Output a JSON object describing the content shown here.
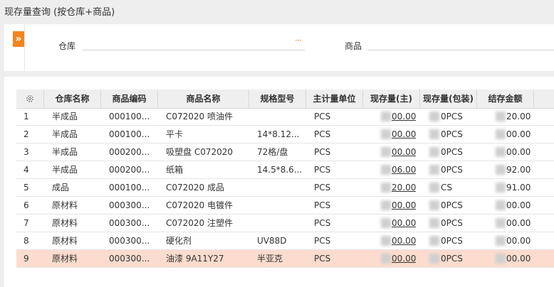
{
  "page": {
    "title": "现存量查询 (按仓库+商品)"
  },
  "filters": {
    "expand_icon": "»",
    "warehouse_label": "仓库",
    "warehouse_value": "",
    "warehouse_more": "···",
    "product_label": "商品",
    "product_value": ""
  },
  "table": {
    "settings_icon": "gear-icon",
    "columns": [
      "仓库名称",
      "商品编码",
      "商品名称",
      "规格型号",
      "主计量单位",
      "现存量(主)",
      "现存量(包装)",
      "结存金额"
    ],
    "rows": [
      {
        "idx": "1",
        "warehouse": "半成品",
        "code": "000100...",
        "name": "C072020 喷油件",
        "spec": "",
        "unit": "PCS",
        "qty_main": "00.00",
        "qty_pack": "0PCS",
        "amount": "20.00"
      },
      {
        "idx": "2",
        "warehouse": "半成品",
        "code": "000100...",
        "name": "平卡",
        "spec": "14*8.12...",
        "unit": "PCS",
        "qty_main": "00.00",
        "qty_pack": "0PCS",
        "amount": "00.00"
      },
      {
        "idx": "3",
        "warehouse": "半成品",
        "code": "000200...",
        "name": "吸塑盘 C072020",
        "spec": "72格/盘",
        "unit": "PCS",
        "qty_main": "00.00",
        "qty_pack": "0PCS",
        "amount": "00.00"
      },
      {
        "idx": "4",
        "warehouse": "半成品",
        "code": "000200...",
        "name": "纸箱",
        "spec": "14.5*8.6...",
        "unit": "PCS",
        "qty_main": "06.00",
        "qty_pack": "0PCS",
        "amount": "92.00"
      },
      {
        "idx": "5",
        "warehouse": "成品",
        "code": "000100...",
        "name": "C072020 成品",
        "spec": "",
        "unit": "PCS",
        "qty_main": "20.00",
        "qty_pack": "CS",
        "amount": "91.00"
      },
      {
        "idx": "6",
        "warehouse": "原材料",
        "code": "000300...",
        "name": "C072020 电镀件",
        "spec": "",
        "unit": "PCS",
        "qty_main": "00.00",
        "qty_pack": "0PCS",
        "amount": "00.00"
      },
      {
        "idx": "7",
        "warehouse": "原材料",
        "code": "000300...",
        "name": "C072020 注塑件",
        "spec": "",
        "unit": "PCS",
        "qty_main": "00.00",
        "qty_pack": "0PCS",
        "amount": "00.00"
      },
      {
        "idx": "8",
        "warehouse": "原材料",
        "code": "000300...",
        "name": "硬化剂",
        "spec": "UV88D",
        "unit": "PCS",
        "qty_main": "00.00",
        "qty_pack": "0PCS",
        "amount": "00.00"
      },
      {
        "idx": "9",
        "warehouse": "原材料",
        "code": "000300...",
        "name": "油漆 9A11Y27",
        "spec": "半亚克",
        "unit": "PCS",
        "qty_main": "00.00",
        "qty_pack": "0PCS",
        "amount": "00.00"
      }
    ],
    "selected_row": 9,
    "selected_color": "#fcdcce"
  }
}
